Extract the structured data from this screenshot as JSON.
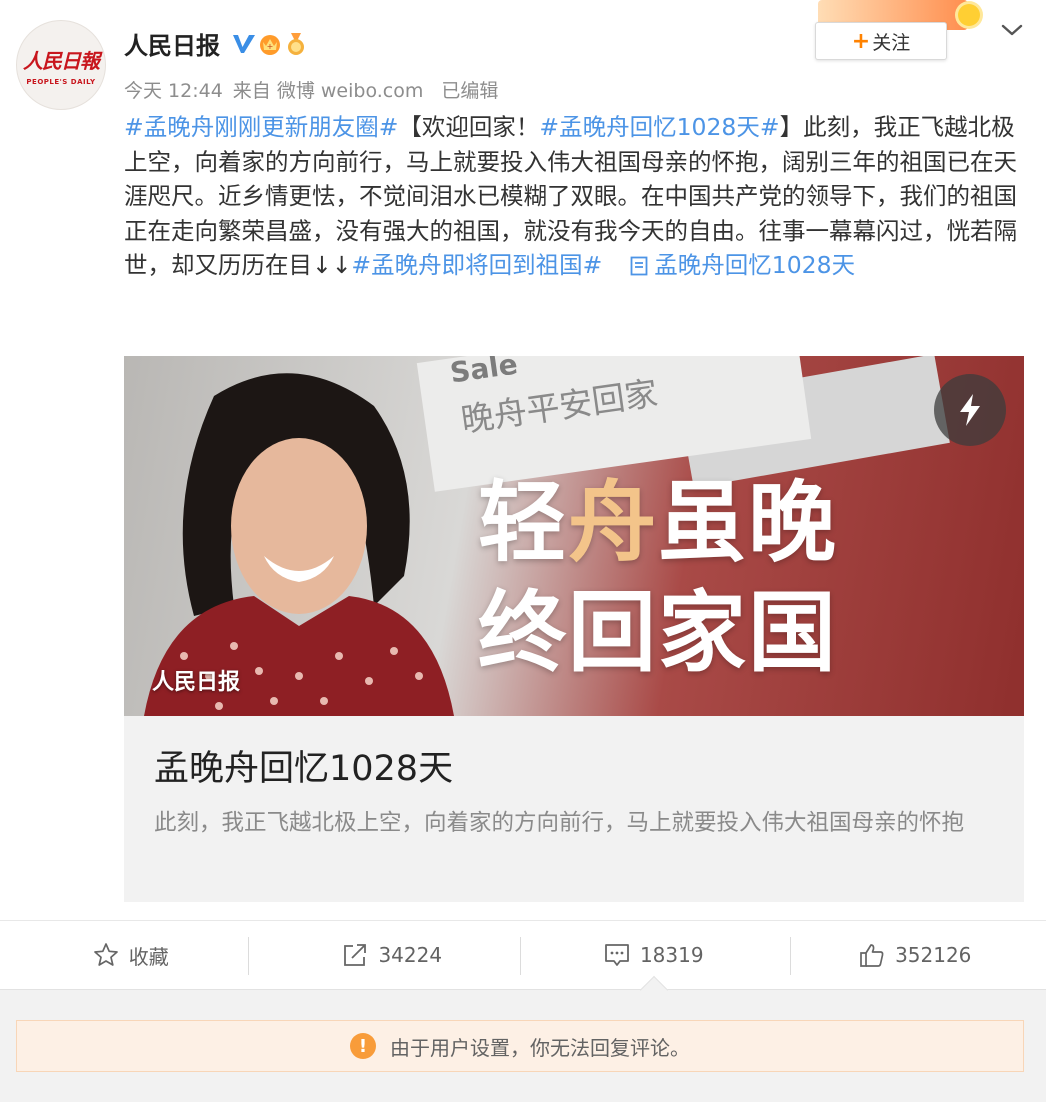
{
  "author": {
    "name": "人民日报",
    "avatar_text": "人民日報",
    "avatar_subtext": "PEOPLE'S DAILY",
    "follow_label": "关注"
  },
  "meta": {
    "time": "今天 12:44",
    "source": "来自 微博 weibo.com",
    "edited": "已编辑"
  },
  "content": {
    "topic1": "#孟晚舟刚刚更新朋友圈#",
    "text1": "【欢迎回家！",
    "topic2": "#孟晚舟回忆1028天#",
    "text2": "】此刻，我正飞越北极上空，向着家的方向前行，马上就要投入伟大祖国母亲的怀抱，阔别三年的祖国已在天涯咫尺。近乡情更怯，不觉间泪水已模糊了双眼。在中国共产党的领导下，我们的祖国正在走向繁荣昌盛，没有强大的祖国，就没有我今天的自由。往事一幕幕闪过，恍若隔世，却又历历在目↓↓",
    "topic3": "#孟晚舟即将回到祖国#",
    "link_text": "孟晚舟回忆1028天"
  },
  "card": {
    "image": {
      "sign_small": "Sale",
      "sign_text": "晚舟平安回家",
      "headline_a": "轻",
      "headline_b": "舟",
      "headline_c": "虽晚",
      "headline_line2": "终回家国",
      "source_label": "人民日报"
    },
    "title": "孟晚舟回忆1028天",
    "description": "此刻，我正飞越北极上空，向着家的方向前行，马上就要投入伟大祖国母亲的怀抱"
  },
  "actions": {
    "favorite": "收藏",
    "repost": "34224",
    "comment": "18319",
    "like": "352126"
  },
  "notice": {
    "icon": "!",
    "text": "由于用户设置，你无法回复评论。"
  },
  "colors": {
    "topic": "#4c94e6",
    "follow_plus": "#ff8200",
    "notice_bg": "#fdf0e5",
    "warn": "#f89c3a"
  }
}
